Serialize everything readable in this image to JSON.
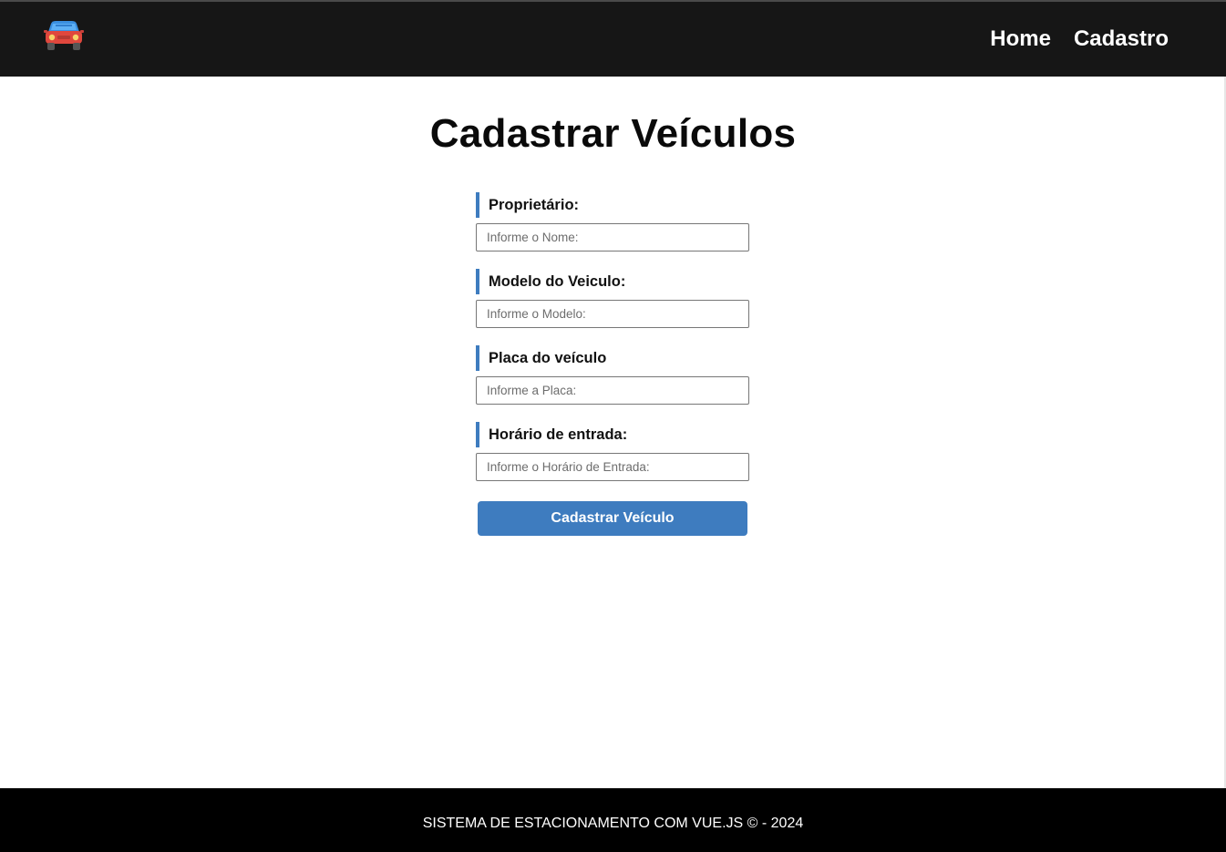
{
  "header": {
    "logo_icon": "car-icon",
    "nav": [
      {
        "label": "Home"
      },
      {
        "label": "Cadastro"
      }
    ]
  },
  "main": {
    "title": "Cadastrar Veículos",
    "fields": [
      {
        "label": "Proprietário:",
        "placeholder": "Informe o Nome:",
        "value": ""
      },
      {
        "label": "Modelo do Veiculo:",
        "placeholder": "Informe o Modelo:",
        "value": ""
      },
      {
        "label": "Placa do veículo",
        "placeholder": "Informe a Placa:",
        "value": ""
      },
      {
        "label": "Horário de entrada:",
        "placeholder": "Informe o Horário de Entrada:",
        "value": ""
      }
    ],
    "submit_label": "Cadastrar Veículo"
  },
  "footer": {
    "text": "SISTEMA DE ESTACIONAMENTO COM VUE.JS © - 2024"
  },
  "colors": {
    "header_bg": "#161616",
    "accent": "#3e7cbf",
    "footer_bg": "#000000"
  }
}
